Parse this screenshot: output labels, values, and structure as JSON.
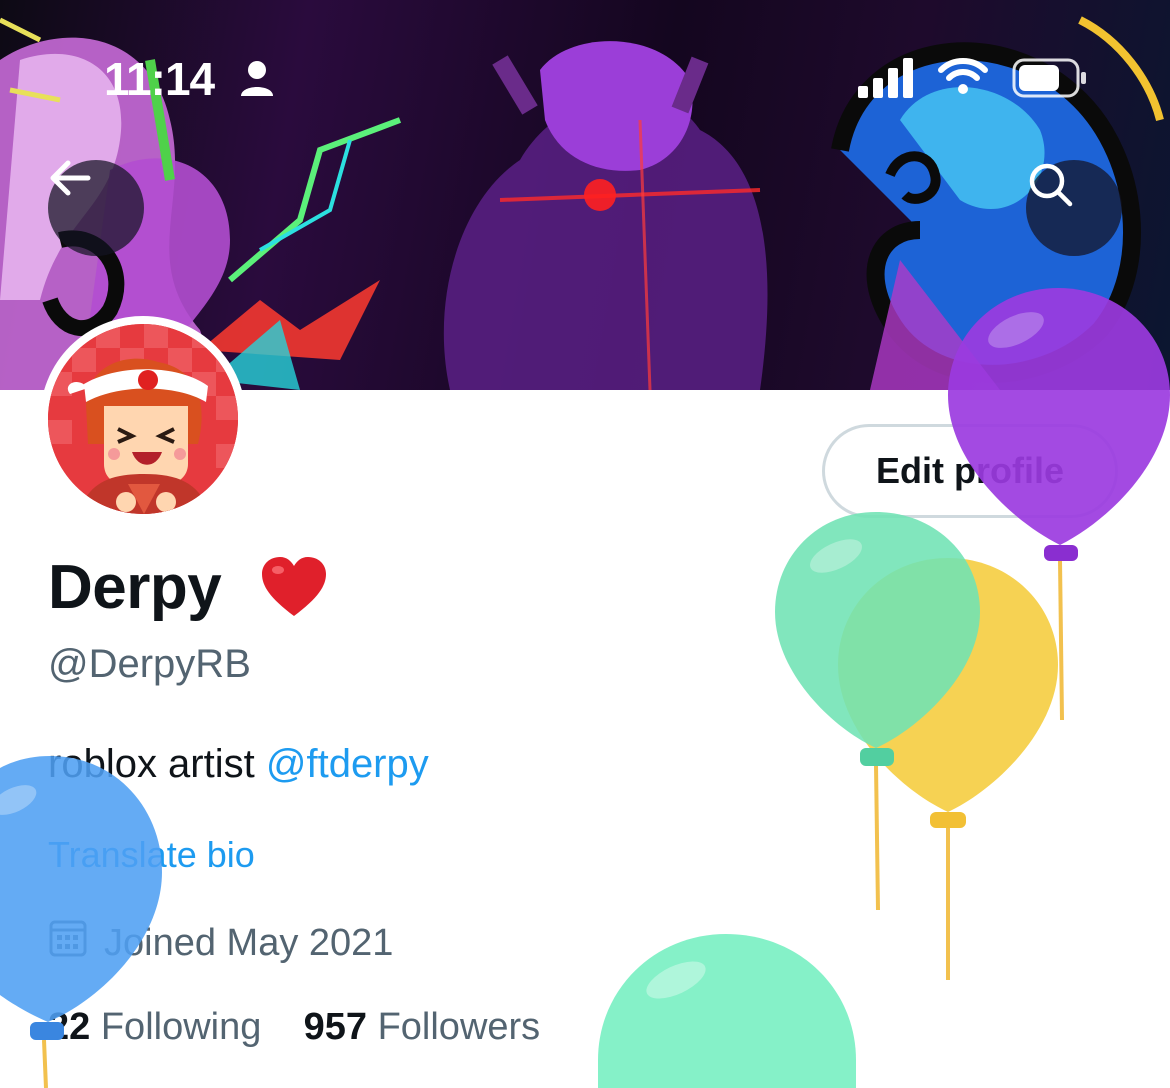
{
  "status_bar": {
    "time": "11:14",
    "icons": [
      "person-icon",
      "cellular-signal-icon",
      "wifi-icon",
      "battery-icon"
    ]
  },
  "header": {
    "back_icon": "arrow-left-icon",
    "search_icon": "search-icon"
  },
  "profile": {
    "display_name": "Derpy",
    "name_emoji": "red-heart-icon",
    "handle": "@DerpyRB",
    "bio_text": "roblox artist ",
    "bio_mention": "@ftderpy",
    "translate_label": "Translate bio",
    "joined": "Joined May 2021",
    "following_count": "22",
    "following_label": "Following",
    "followers_count": "957",
    "followers_label": "Followers"
  },
  "actions": {
    "edit_profile_label": "Edit profile"
  },
  "colors": {
    "link_blue": "#1d9bf0",
    "text_primary": "#0f1419",
    "text_secondary": "#536471",
    "avatar_red": "#e8333a"
  },
  "decorations": [
    "balloon-purple",
    "balloon-green",
    "balloon-yellow",
    "balloon-blue",
    "balloon-teal"
  ]
}
